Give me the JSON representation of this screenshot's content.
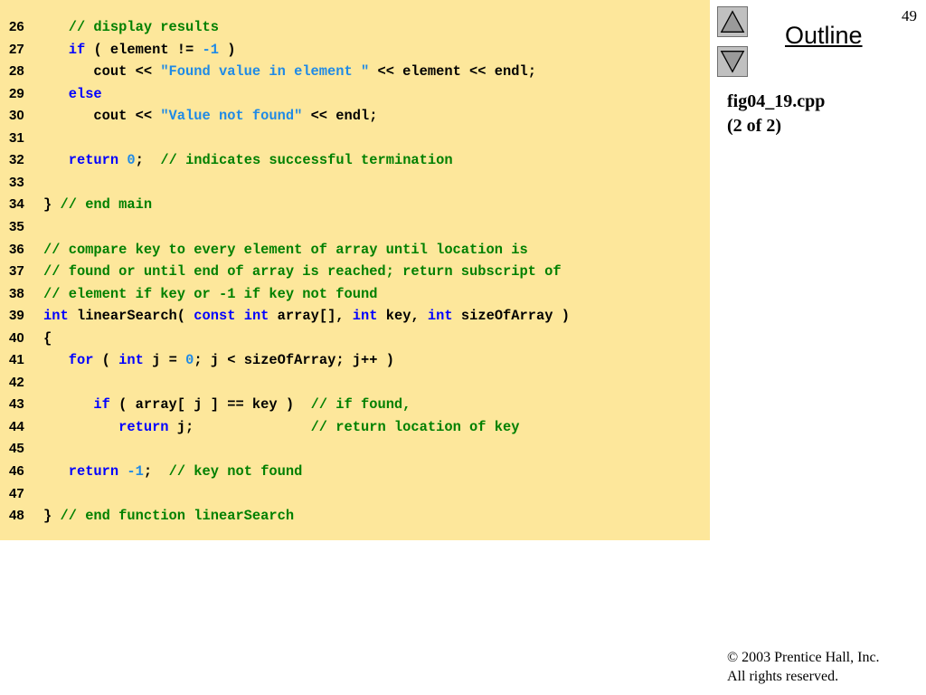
{
  "slide": {
    "page_number": "49",
    "outline_label": "Outline",
    "file_name": "fig04_19.cpp",
    "part": "(2 of 2)",
    "copyright_line1": "© 2003 Prentice Hall, Inc.",
    "copyright_line2": "All rights reserved."
  },
  "navigation": {
    "up_icon": "triangle-up-icon",
    "down_icon": "triangle-down-icon"
  },
  "colors": {
    "code_background": "#fde79b",
    "keyword": "#0000ff",
    "comment": "#008000",
    "literal": "#1f8ae6",
    "plain": "#000000"
  },
  "code_lines": [
    {
      "number": "26",
      "tokens": [
        {
          "type": "comment",
          "text": "   // display results"
        }
      ]
    },
    {
      "number": "27",
      "tokens": [
        {
          "type": "plain",
          "text": "   "
        },
        {
          "type": "kw",
          "text": "if"
        },
        {
          "type": "plain",
          "text": " ( element != "
        },
        {
          "type": "num",
          "text": "-1"
        },
        {
          "type": "plain",
          "text": " )"
        }
      ]
    },
    {
      "number": "28",
      "tokens": [
        {
          "type": "plain",
          "text": "      cout << "
        },
        {
          "type": "str",
          "text": "\"Found value in element \""
        },
        {
          "type": "plain",
          "text": " << element << endl;"
        }
      ]
    },
    {
      "number": "29",
      "tokens": [
        {
          "type": "plain",
          "text": "   "
        },
        {
          "type": "kw",
          "text": "else"
        }
      ]
    },
    {
      "number": "30",
      "tokens": [
        {
          "type": "plain",
          "text": "      cout << "
        },
        {
          "type": "str",
          "text": "\"Value not found\""
        },
        {
          "type": "plain",
          "text": " << endl;"
        }
      ]
    },
    {
      "number": "31",
      "tokens": []
    },
    {
      "number": "32",
      "tokens": [
        {
          "type": "plain",
          "text": "   "
        },
        {
          "type": "kw",
          "text": "return"
        },
        {
          "type": "plain",
          "text": " "
        },
        {
          "type": "num",
          "text": "0"
        },
        {
          "type": "plain",
          "text": ";  "
        },
        {
          "type": "comment",
          "text": "// indicates successful termination"
        }
      ]
    },
    {
      "number": "33",
      "tokens": []
    },
    {
      "number": "34",
      "tokens": [
        {
          "type": "plain",
          "text": "} "
        },
        {
          "type": "comment",
          "text": "// end main"
        }
      ]
    },
    {
      "number": "35",
      "tokens": []
    },
    {
      "number": "36",
      "tokens": [
        {
          "type": "comment",
          "text": "// compare key to every element of array until location is"
        }
      ]
    },
    {
      "number": "37",
      "tokens": [
        {
          "type": "comment",
          "text": "// found or until end of array is reached; return subscript of"
        }
      ]
    },
    {
      "number": "38",
      "tokens": [
        {
          "type": "comment",
          "text": "// element if key or -1 if key not found"
        }
      ]
    },
    {
      "number": "39",
      "tokens": [
        {
          "type": "kw",
          "text": "int"
        },
        {
          "type": "plain",
          "text": " linearSearch( "
        },
        {
          "type": "kw",
          "text": "const"
        },
        {
          "type": "plain",
          "text": " "
        },
        {
          "type": "kw",
          "text": "int"
        },
        {
          "type": "plain",
          "text": " array[], "
        },
        {
          "type": "kw",
          "text": "int"
        },
        {
          "type": "plain",
          "text": " key, "
        },
        {
          "type": "kw",
          "text": "int"
        },
        {
          "type": "plain",
          "text": " sizeOfArray )"
        }
      ]
    },
    {
      "number": "40",
      "tokens": [
        {
          "type": "plain",
          "text": "{"
        }
      ]
    },
    {
      "number": "41",
      "tokens": [
        {
          "type": "plain",
          "text": "   "
        },
        {
          "type": "kw",
          "text": "for"
        },
        {
          "type": "plain",
          "text": " ( "
        },
        {
          "type": "kw",
          "text": "int"
        },
        {
          "type": "plain",
          "text": " j = "
        },
        {
          "type": "num",
          "text": "0"
        },
        {
          "type": "plain",
          "text": "; j < sizeOfArray; j++ )"
        }
      ]
    },
    {
      "number": "42",
      "tokens": []
    },
    {
      "number": "43",
      "tokens": [
        {
          "type": "plain",
          "text": "      "
        },
        {
          "type": "kw",
          "text": "if"
        },
        {
          "type": "plain",
          "text": " ( array[ j ] == key )  "
        },
        {
          "type": "comment",
          "text": "// if found,"
        }
      ]
    },
    {
      "number": "44",
      "tokens": [
        {
          "type": "plain",
          "text": "         "
        },
        {
          "type": "kw",
          "text": "return"
        },
        {
          "type": "plain",
          "text": " j;              "
        },
        {
          "type": "comment",
          "text": "// return location of key"
        }
      ]
    },
    {
      "number": "45",
      "tokens": []
    },
    {
      "number": "46",
      "tokens": [
        {
          "type": "plain",
          "text": "   "
        },
        {
          "type": "kw",
          "text": "return"
        },
        {
          "type": "plain",
          "text": " "
        },
        {
          "type": "num",
          "text": "-1"
        },
        {
          "type": "plain",
          "text": ";  "
        },
        {
          "type": "comment",
          "text": "// key not found"
        }
      ]
    },
    {
      "number": "47",
      "tokens": []
    },
    {
      "number": "48",
      "tokens": [
        {
          "type": "plain",
          "text": "} "
        },
        {
          "type": "comment",
          "text": "// end function linearSearch"
        }
      ]
    }
  ]
}
